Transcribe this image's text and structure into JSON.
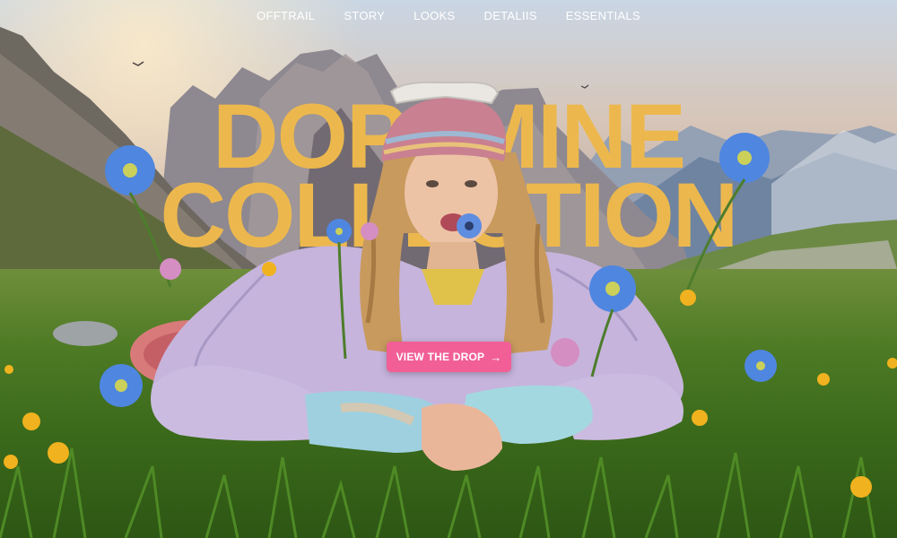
{
  "nav": {
    "items": [
      {
        "label": "OFFTRAIL"
      },
      {
        "label": "STORY"
      },
      {
        "label": "LOOKS"
      },
      {
        "label": "DETALIIS"
      },
      {
        "label": "ESSENTIALS"
      }
    ]
  },
  "hero": {
    "headline_line1": "DOPAMINE",
    "headline_line2": "COLLECTION",
    "cta_label": "VIEW THE DROP",
    "cta_icon": "arrow-right-icon",
    "cta_arrow": "→"
  },
  "colors": {
    "headline": "#ecb84e",
    "cta": "#f15f96",
    "nav_text": "#ffffff"
  }
}
